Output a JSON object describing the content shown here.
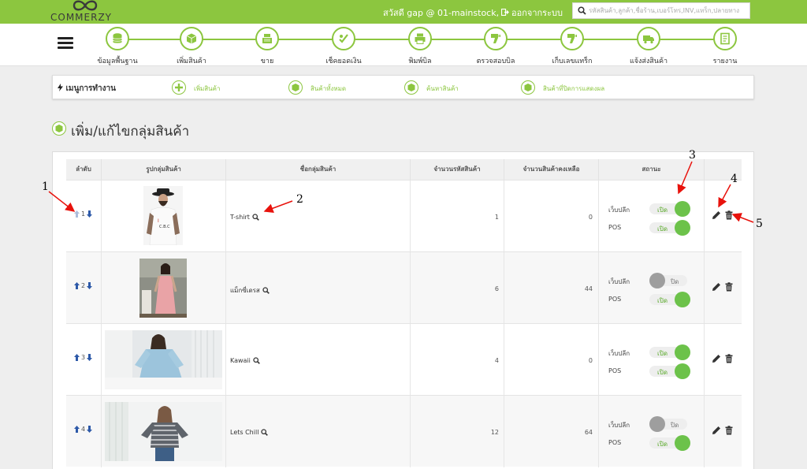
{
  "header": {
    "logo_text": "COMMERZY",
    "greeting": "สวัสดี gap @ 01-mainstock,",
    "logout_label": "ออกจากระบบ",
    "search_placeholder": "รหัสสินค้า,ลูกค้า,ชื่อร้าน,เบอร์โทร,INV,แทร็ก,ปลายทาง",
    "accent_color": "#8cc63f"
  },
  "nav": {
    "items": [
      {
        "label": "ข้อมูลพื้นฐาน",
        "icon": "database-icon"
      },
      {
        "label": "เพิ่มสินค้า",
        "icon": "box-icon"
      },
      {
        "label": "ขาย",
        "icon": "cash-register-icon"
      },
      {
        "label": "เช็คยอดเงิน",
        "icon": "money-check-icon"
      },
      {
        "label": "พิมพ์บิล",
        "icon": "printer-icon"
      },
      {
        "label": "ตรวจสอบบิล",
        "icon": "barcode-scanner-icon"
      },
      {
        "label": "เก็บเลขแทร็ก",
        "icon": "barcode-scanner-icon"
      },
      {
        "label": "แจ้งส่งสินค้า",
        "icon": "truck-icon"
      },
      {
        "label": "รายงาน",
        "icon": "report-icon"
      }
    ]
  },
  "work_menu": {
    "title": "เมนูการทำงาน",
    "items": [
      {
        "label": "เพิ่มสินค้า",
        "icon": "plus-icon"
      },
      {
        "label": "สินค้าทั้งหมด",
        "icon": "box-icon"
      },
      {
        "label": "ค้นหาสินค้า",
        "icon": "box-icon"
      },
      {
        "label": "สินค้าที่ปิดการแสดงผล",
        "icon": "box-icon"
      }
    ]
  },
  "page_title": "เพิ่ม/แก้ไขกลุ่มสินค้า",
  "table": {
    "headers": [
      "ลำดับ",
      "รูปกลุ่มสินค้า",
      "ชื่อกลุ่มสินค้า",
      "จำนวนรหัสสินค้า",
      "จำนวนสินค้าคงเหลือ",
      "สถานะ",
      ""
    ],
    "status_labels": {
      "web": "เว็บปลีก",
      "pos": "POS"
    },
    "toggle_text": {
      "on": "เปิด",
      "off": "ปิด"
    },
    "rows": [
      {
        "order": "1",
        "name": "T-shirt",
        "sku_count": "1",
        "stock": "0",
        "web_on": true,
        "pos_on": true
      },
      {
        "order": "2",
        "name": "แม็กซี่เดรส",
        "sku_count": "6",
        "stock": "44",
        "web_on": false,
        "pos_on": true
      },
      {
        "order": "3",
        "name": "Kawaii",
        "sku_count": "4",
        "stock": "0",
        "web_on": true,
        "pos_on": true
      },
      {
        "order": "4",
        "name": "Lets Chill",
        "sku_count": "12",
        "stock": "64",
        "web_on": false,
        "pos_on": true
      }
    ]
  },
  "annotations": [
    "1",
    "2",
    "3",
    "4",
    "5"
  ]
}
